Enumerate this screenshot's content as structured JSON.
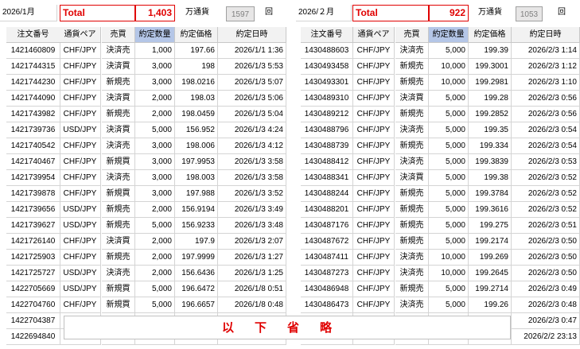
{
  "left": {
    "month_label": "2026/1月",
    "total_label": "Total",
    "total_value": "1,403",
    "unit_label": "万通貨",
    "count_value": "1597",
    "count_unit": "回",
    "headers": [
      "注文番号",
      "通貨ペア",
      "売買",
      "約定数量",
      "約定価格",
      "約定日時"
    ],
    "rows": [
      [
        "1421460809",
        "CHF/JPY",
        "決済売",
        "1,000",
        "197.66",
        "2026/1/1 1:36"
      ],
      [
        "1421744315",
        "CHF/JPY",
        "決済買",
        "3,000",
        "198",
        "2026/1/3 5:53"
      ],
      [
        "1421744230",
        "CHF/JPY",
        "新規売",
        "3,000",
        "198.0216",
        "2026/1/3 5:07"
      ],
      [
        "1421744090",
        "CHF/JPY",
        "決済買",
        "2,000",
        "198.03",
        "2026/1/3 5:06"
      ],
      [
        "1421743982",
        "CHF/JPY",
        "新規売",
        "2,000",
        "198.0459",
        "2026/1/3 5:04"
      ],
      [
        "1421739736",
        "USD/JPY",
        "決済買",
        "5,000",
        "156.952",
        "2026/1/3 4:24"
      ],
      [
        "1421740542",
        "CHF/JPY",
        "決済売",
        "3,000",
        "198.006",
        "2026/1/3 4:12"
      ],
      [
        "1421740467",
        "CHF/JPY",
        "新規買",
        "3,000",
        "197.9953",
        "2026/1/3 3:58"
      ],
      [
        "1421739954",
        "CHF/JPY",
        "決済売",
        "3,000",
        "198.003",
        "2026/1/3 3:58"
      ],
      [
        "1421739878",
        "CHF/JPY",
        "新規買",
        "3,000",
        "197.988",
        "2026/1/3 3:52"
      ],
      [
        "1421739656",
        "USD/JPY",
        "新規売",
        "2,000",
        "156.9194",
        "2026/1/3 3:49"
      ],
      [
        "1421739627",
        "USD/JPY",
        "新規売",
        "5,000",
        "156.9233",
        "2026/1/3 3:48"
      ],
      [
        "1421726140",
        "CHF/JPY",
        "決済買",
        "2,000",
        "197.9",
        "2026/1/3 2:07"
      ],
      [
        "1421725903",
        "CHF/JPY",
        "新規売",
        "2,000",
        "197.9999",
        "2026/1/3 1:27"
      ],
      [
        "1421725727",
        "USD/JPY",
        "決済売",
        "2,000",
        "156.6436",
        "2026/1/3 1:25"
      ],
      [
        "1422705669",
        "USD/JPY",
        "新規買",
        "5,000",
        "196.6472",
        "2026/1/8 0:51"
      ],
      [
        "1422704760",
        "CHF/JPY",
        "新規買",
        "5,000",
        "196.6657",
        "2026/1/8 0:48"
      ],
      [
        "1422704387",
        "",
        "",
        "",
        "",
        ""
      ],
      [
        "1422694840",
        "",
        "",
        "",
        "",
        ""
      ]
    ]
  },
  "right": {
    "month_label": "2026/２月",
    "total_label": "Total",
    "total_value": "922",
    "unit_label": "万通貨",
    "count_value": "1053",
    "count_unit": "回",
    "headers": [
      "注文番号",
      "通貨ペア",
      "売買",
      "約定数量",
      "約定価格",
      "約定日時"
    ],
    "rows": [
      [
        "1430488603",
        "CHF/JPY",
        "決済売",
        "5,000",
        "199.39",
        "2026/2/3 1:14"
      ],
      [
        "1430493458",
        "CHF/JPY",
        "新規売",
        "10,000",
        "199.3001",
        "2026/2/3 1:12"
      ],
      [
        "1430493301",
        "CHF/JPY",
        "新規売",
        "10,000",
        "199.2981",
        "2026/2/3 1:10"
      ],
      [
        "1430489310",
        "CHF/JPY",
        "決済買",
        "5,000",
        "199.28",
        "2026/2/3 0:56"
      ],
      [
        "1430489212",
        "CHF/JPY",
        "新規売",
        "5,000",
        "199.2852",
        "2026/2/3 0:56"
      ],
      [
        "1430488796",
        "CHF/JPY",
        "決済売",
        "5,000",
        "199.35",
        "2026/2/3 0:54"
      ],
      [
        "1430488739",
        "CHF/JPY",
        "新規売",
        "5,000",
        "199.334",
        "2026/2/3 0:54"
      ],
      [
        "1430488412",
        "CHF/JPY",
        "決済売",
        "5,000",
        "199.3839",
        "2026/2/3 0:53"
      ],
      [
        "1430488341",
        "CHF/JPY",
        "決済買",
        "5,000",
        "199.38",
        "2026/2/3 0:52"
      ],
      [
        "1430488244",
        "CHF/JPY",
        "新規売",
        "5,000",
        "199.3784",
        "2026/2/3 0:52"
      ],
      [
        "1430488201",
        "CHF/JPY",
        "新規売",
        "5,000",
        "199.3616",
        "2026/2/3 0:52"
      ],
      [
        "1430487176",
        "CHF/JPY",
        "新規売",
        "5,000",
        "199.275",
        "2026/2/3 0:51"
      ],
      [
        "1430487672",
        "CHF/JPY",
        "新規売",
        "5,000",
        "199.2174",
        "2026/2/3 0:50"
      ],
      [
        "1430487411",
        "CHF/JPY",
        "決済売",
        "10,000",
        "199.269",
        "2026/2/3 0:50"
      ],
      [
        "1430487273",
        "CHF/JPY",
        "決済売",
        "10,000",
        "199.2645",
        "2026/2/3 0:50"
      ],
      [
        "1430486948",
        "CHF/JPY",
        "新規売",
        "5,000",
        "199.2714",
        "2026/2/3 0:49"
      ],
      [
        "1430486473",
        "CHF/JPY",
        "決済売",
        "5,000",
        "199.26",
        "2026/2/3 0:48"
      ],
      [
        "",
        "",
        "",
        "",
        "",
        "2026/2/3 0:47"
      ],
      [
        "",
        "",
        "",
        "",
        "",
        "2026/2/2 23:13"
      ]
    ]
  },
  "banner_text": "以下省略",
  "accent_color": "#e00000",
  "header_selected_color": "#b4c6e7"
}
